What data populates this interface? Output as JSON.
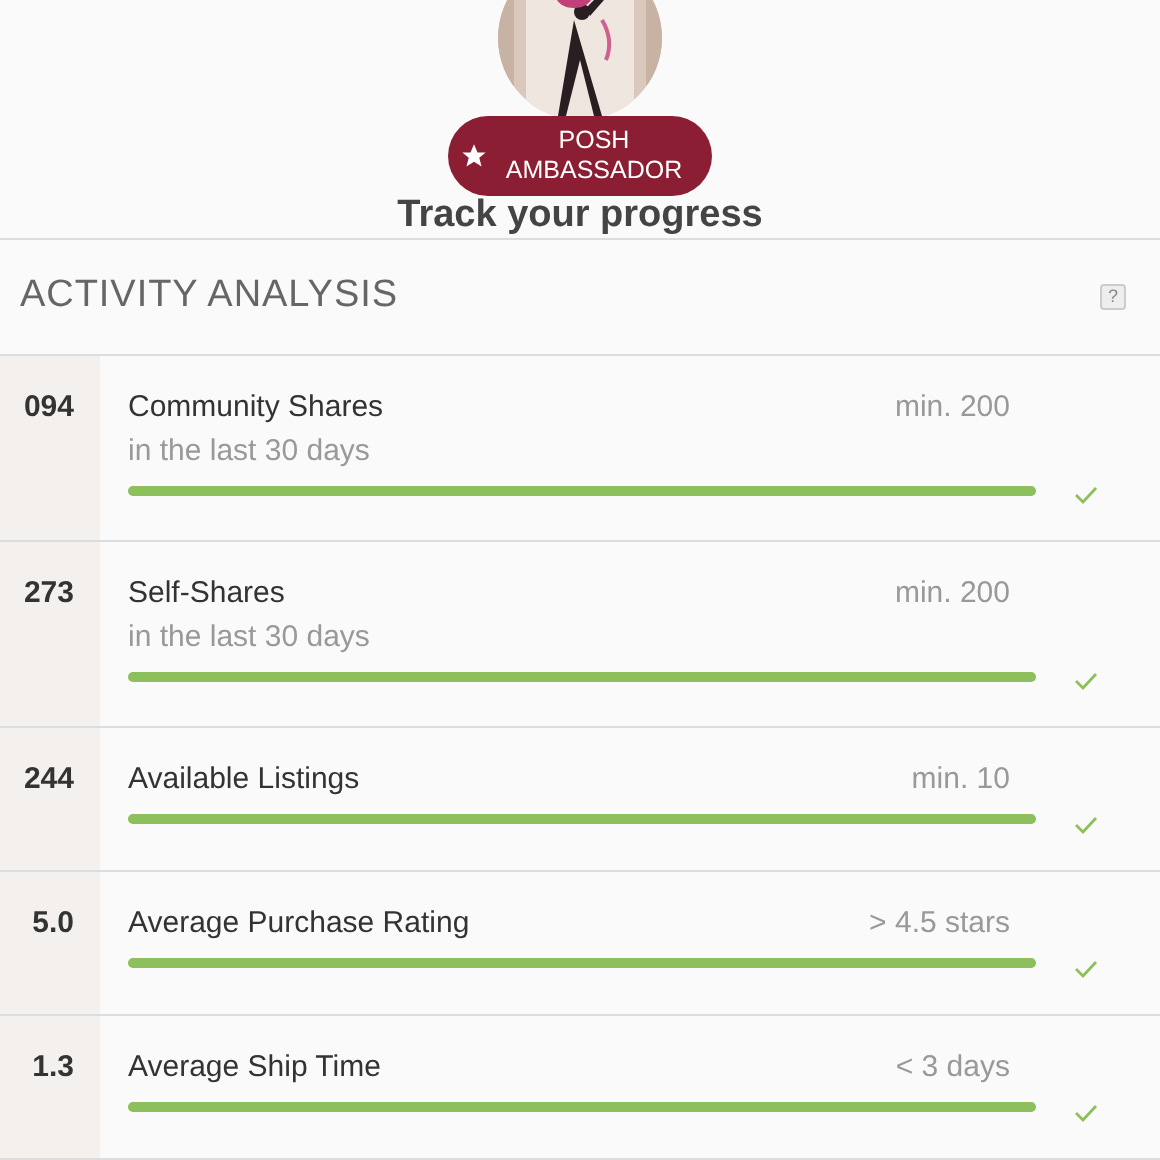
{
  "header": {
    "badge": "POSH\nAMBASSADOR",
    "title": "Track your progress"
  },
  "section": {
    "title": "ACTIVITY ANALYSIS",
    "help": "?"
  },
  "metrics": [
    {
      "value": "094",
      "title": "Community Shares",
      "subtitle": "in the last 30 days",
      "requirement": "min. 200",
      "level": 1,
      "met": true
    },
    {
      "value": "273",
      "title": "Self-Shares",
      "subtitle": "in the last 30 days",
      "requirement": "min. 200",
      "level": 1,
      "met": true
    },
    {
      "value": "244",
      "title": "Available Listings",
      "requirement": "min. 10",
      "level": 1,
      "met": true
    },
    {
      "value": "5.0",
      "title": "Average Purchase Rating",
      "requirement": "> 4.5 stars",
      "level": 1,
      "met": true
    },
    {
      "value": "1.3",
      "title": "Average Ship Time",
      "requirement": "< 3 days",
      "level": 1,
      "met": true
    }
  ]
}
